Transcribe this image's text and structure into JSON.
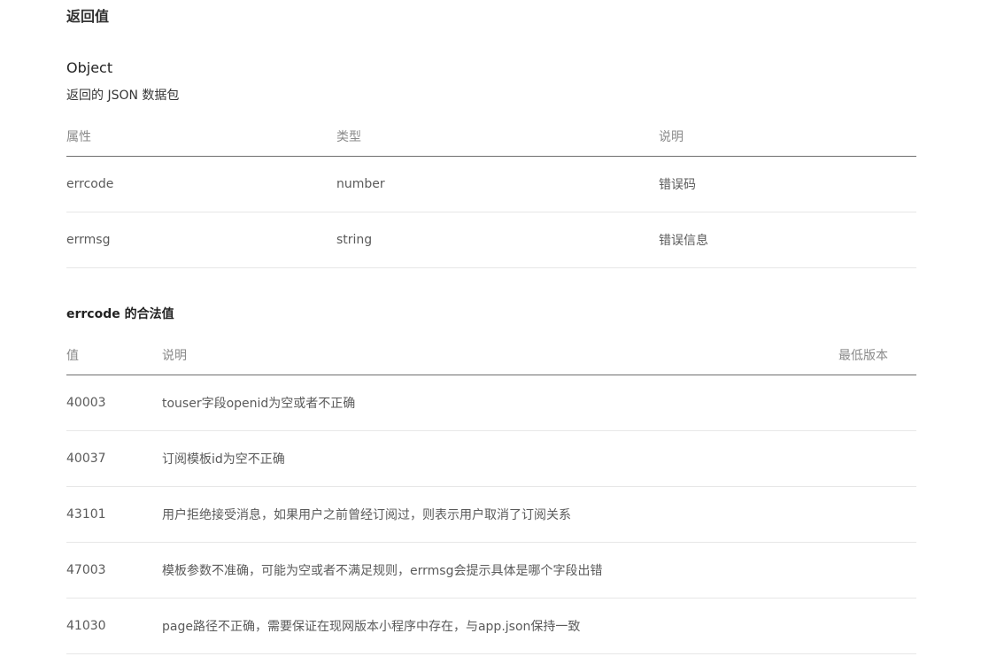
{
  "section_heading": "返回值",
  "return_type": {
    "name": "Object",
    "description": "返回的 JSON 数据包"
  },
  "props_table": {
    "headers": [
      "属性",
      "类型",
      "说明"
    ],
    "rows": [
      [
        "errcode",
        "number",
        "错误码"
      ],
      [
        "errmsg",
        "string",
        "错误信息"
      ]
    ]
  },
  "errcode_section": {
    "title": "errcode 的合法值",
    "headers": [
      "值",
      "说明",
      "最低版本"
    ],
    "rows": [
      [
        "40003",
        "touser字段openid为空或者不正确",
        ""
      ],
      [
        "40037",
        "订阅模板id为空不正确",
        ""
      ],
      [
        "43101",
        "用户拒绝接受消息，如果用户之前曾经订阅过，则表示用户取消了订阅关系",
        ""
      ],
      [
        "47003",
        "模板参数不准确，可能为空或者不满足规则，errmsg会提示具体是哪个字段出错",
        ""
      ],
      [
        "41030",
        "page路径不正确，需要保证在现网版本小程序中存在，与app.json保持一致",
        ""
      ]
    ]
  }
}
